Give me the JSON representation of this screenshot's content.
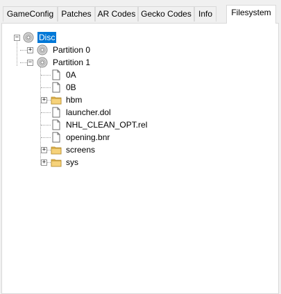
{
  "tabs": [
    {
      "label": "GameConfig",
      "active": false
    },
    {
      "label": "Patches",
      "active": false
    },
    {
      "label": "AR Codes",
      "active": false
    },
    {
      "label": "Gecko Codes",
      "active": false
    },
    {
      "label": "Info",
      "active": false
    },
    {
      "label": "Filesystem",
      "active": true
    }
  ],
  "tree": {
    "root": {
      "label": "Disc",
      "icon": "disc-icon",
      "expanded": true,
      "selected": true
    },
    "partitions": [
      {
        "label": "Partition 0",
        "icon": "disc-icon",
        "expanded": false
      },
      {
        "label": "Partition 1",
        "icon": "disc-icon",
        "expanded": true
      }
    ],
    "partition1_children": [
      {
        "label": "0A",
        "icon": "file-icon",
        "expandable": false
      },
      {
        "label": "0B",
        "icon": "file-icon",
        "expandable": false
      },
      {
        "label": "hbm",
        "icon": "folder-icon",
        "expandable": true
      },
      {
        "label": "launcher.dol",
        "icon": "file-icon",
        "expandable": false
      },
      {
        "label": "NHL_CLEAN_OPT.rel",
        "icon": "file-icon",
        "expandable": false
      },
      {
        "label": "opening.bnr",
        "icon": "file-icon",
        "expandable": false
      },
      {
        "label": "screens",
        "icon": "folder-icon",
        "expandable": true
      },
      {
        "label": "sys",
        "icon": "folder-icon",
        "expandable": true
      }
    ]
  },
  "colors": {
    "selection": "#0078d7",
    "folder": "#e8b84a",
    "panel": "#ffffff",
    "chrome": "#f0f0f0"
  }
}
